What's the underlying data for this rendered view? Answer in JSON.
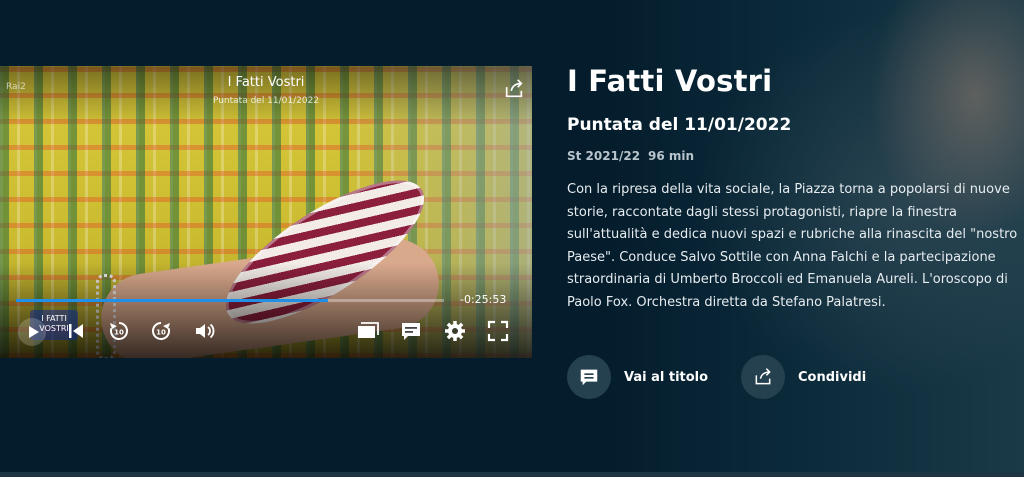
{
  "player": {
    "channel_logo_text": "Rai2",
    "title": "I Fatti Vostri",
    "subtitle": "Puntata del 11/01/2022",
    "time_remaining": "-0:25:53",
    "progress": 0.73,
    "show_logo_text": "I FATTI VOSTRI",
    "icons": {
      "share": "share-icon",
      "play": "play-icon",
      "skip_back": "skip-back-icon",
      "rewind": "rewind-10-icon",
      "forward": "forward-10-icon",
      "volume": "volume-icon",
      "episodes": "episodes-icon",
      "subtitles": "subtitles-icon",
      "settings": "gear-icon",
      "fullscreen": "fullscreen-icon"
    },
    "accent_color": "#1f8fe8"
  },
  "info": {
    "title": "I Fatti Vostri",
    "episode": "Puntata del 11/01/2022",
    "season": "St 2021/22",
    "duration": "96 min",
    "description": "Con la ripresa della vita sociale, la Piazza torna a popolarsi di nuove storie, raccontate dagli stessi protagonisti, riapre la finestra sull'attualità e dedica nuovi spazi e rubriche alla rinascita del \"nostro Paese\". Conduce Salvo Sottile con Anna Falchi e la partecipazione straordinaria di Umberto Broccoli ed Emanuela Aureli. L'oroscopo di Paolo Fox. Orchestra diretta da Stefano Palatresi."
  },
  "actions": {
    "go_to_title_label": "Vai al titolo",
    "share_label": "Condividi"
  },
  "colors": {
    "background": "#041c2c",
    "button_circle": "#25404f"
  }
}
